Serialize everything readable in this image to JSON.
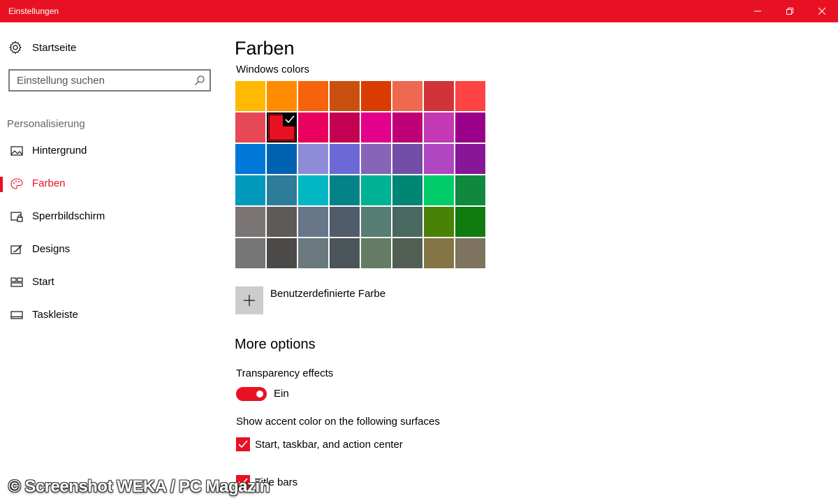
{
  "window": {
    "title": "Einstellungen",
    "accent_color": "#e81123"
  },
  "sidebar": {
    "home_label": "Startseite",
    "home_icon": "gear-icon",
    "search_placeholder": "Einstellung suchen",
    "search_icon": "search-icon",
    "section_label": "Personalisierung",
    "items": [
      {
        "label": "Hintergrund",
        "icon": "picture-icon",
        "active": false
      },
      {
        "label": "Farben",
        "icon": "palette-icon",
        "active": true
      },
      {
        "label": "Sperrbildschirm",
        "icon": "lockscreen-icon",
        "active": false
      },
      {
        "label": "Designs",
        "icon": "designs-icon",
        "active": false
      },
      {
        "label": "Start",
        "icon": "start-icon",
        "active": false
      },
      {
        "label": "Taskleiste",
        "icon": "taskbar-icon",
        "active": false
      }
    ]
  },
  "main": {
    "title": "Farben",
    "windows_colors_label": "Windows colors",
    "selected_color": "#e81123",
    "swatches": [
      "#ffb900",
      "#ff8c00",
      "#f7630c",
      "#ca5010",
      "#da3b01",
      "#ef6950",
      "#d13438",
      "#ff4343",
      "#e74856",
      "#e81123",
      "#ea005e",
      "#c30052",
      "#e3008c",
      "#bf0077",
      "#c239b3",
      "#9a0089",
      "#0078d7",
      "#0063b1",
      "#8e8cd8",
      "#6b69d6",
      "#8764b8",
      "#744da9",
      "#b146c2",
      "#881798",
      "#0099bc",
      "#2d7d9a",
      "#00b7c3",
      "#038387",
      "#00b294",
      "#018574",
      "#00cc6a",
      "#10893e",
      "#7a7574",
      "#5d5a58",
      "#68768a",
      "#515c6b",
      "#567c73",
      "#486860",
      "#498205",
      "#107c10",
      "#767676",
      "#4c4a48",
      "#69797e",
      "#4a5459",
      "#647c64",
      "#525e54",
      "#847545",
      "#7e735f"
    ],
    "custom_color_label": "Benutzerdefinierte Farbe",
    "custom_color_icon": "plus-icon",
    "more_options_label": "More options",
    "transparency_label": "Transparency effects",
    "transparency_state": "Ein",
    "accent_surfaces_label": "Show accent color on the following surfaces",
    "checkbox_start_label": "Start, taskbar, and action center",
    "checkbox_title_label": "Title bars"
  },
  "watermark": "© Screenshot WEKA / PC Magazin"
}
